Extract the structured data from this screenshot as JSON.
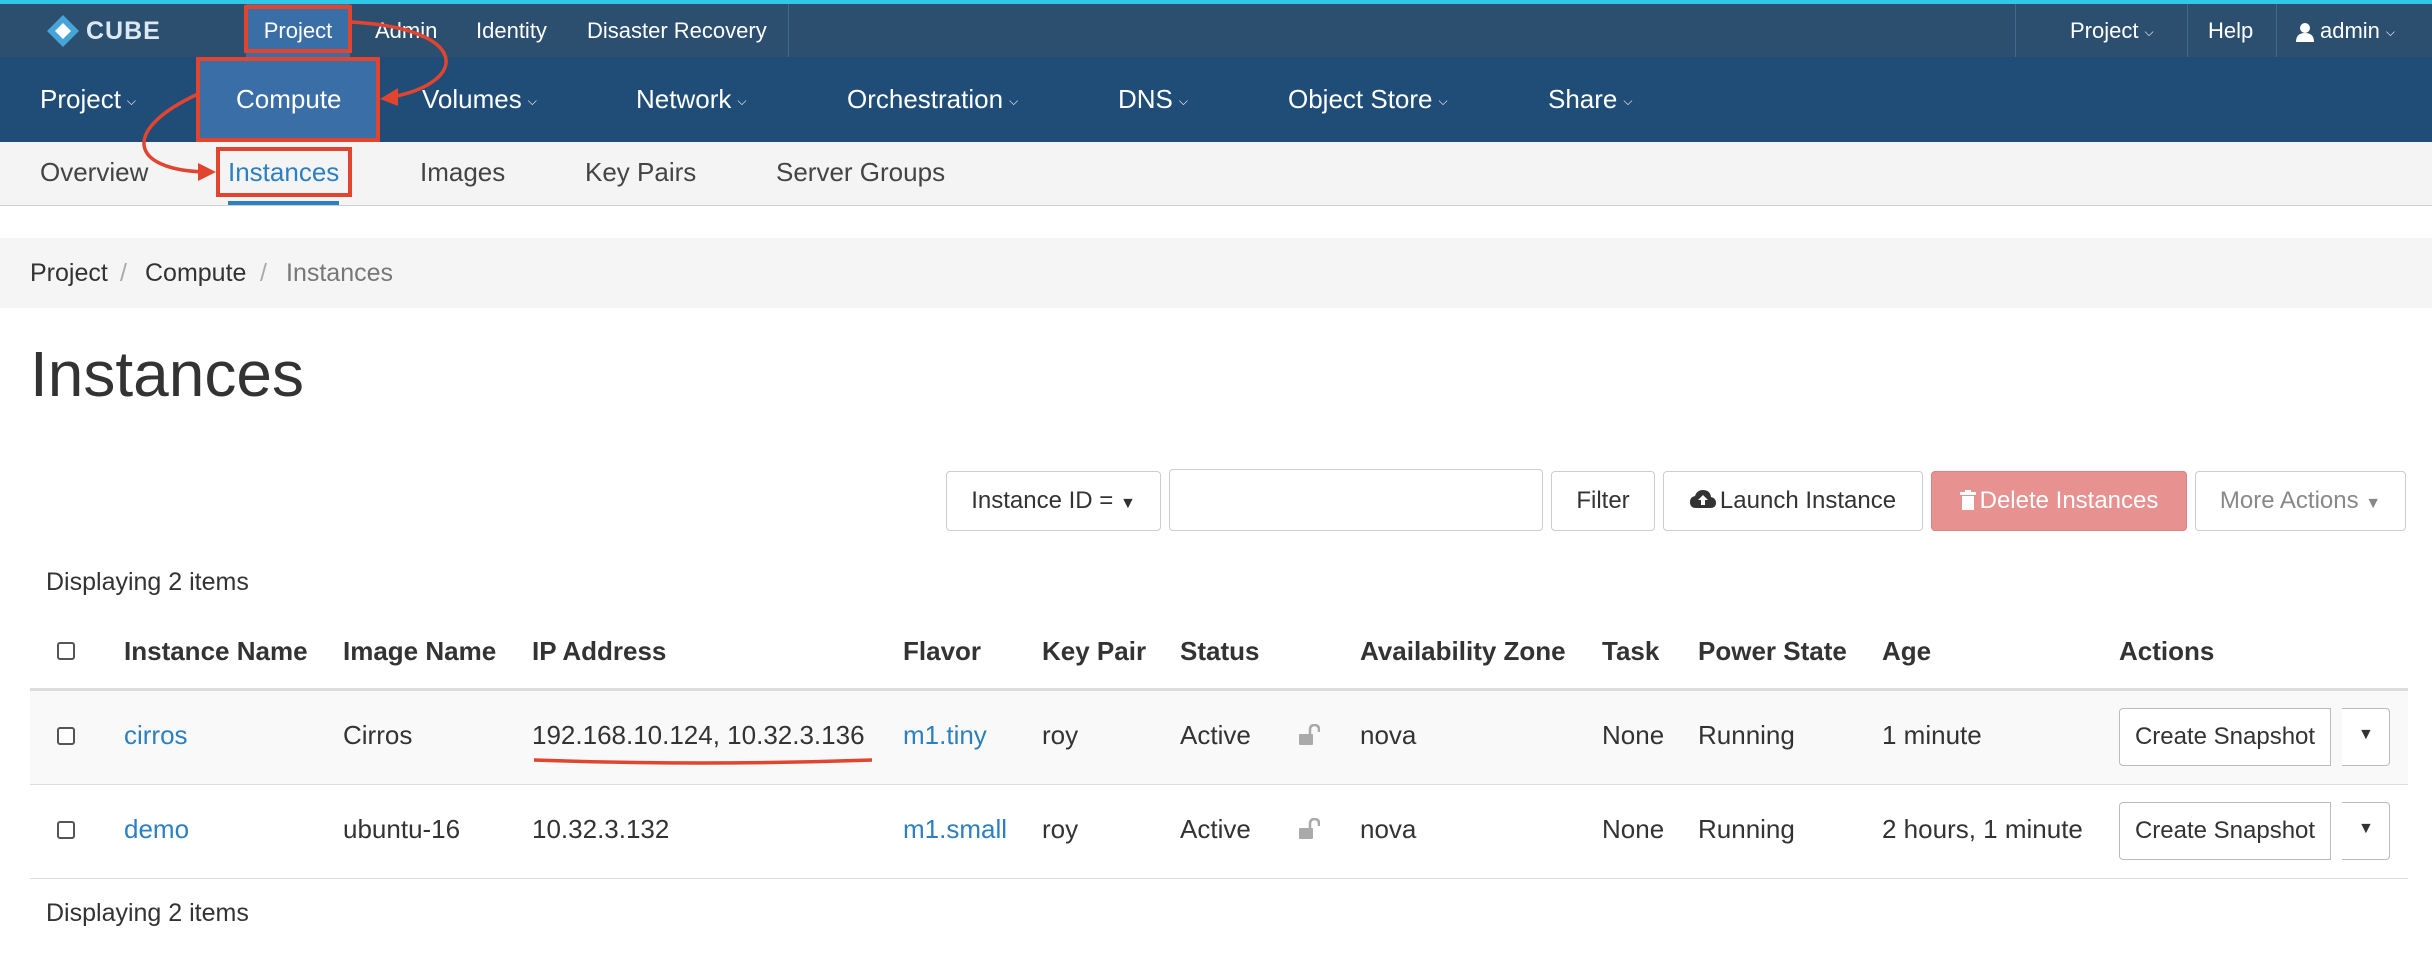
{
  "colors": {
    "top_bar": "#2c4f70",
    "main_nav": "#1f4d77",
    "active_tab": "#3a6ea7",
    "link": "#2c7fc1",
    "danger": "#e79191",
    "annotation": "#e1452f"
  },
  "brand": {
    "logo_text": "CUBE",
    "icon": "cube-diamond-icon"
  },
  "top_nav": {
    "items": [
      "Project",
      "Admin",
      "Identity",
      "Disaster Recovery"
    ],
    "right": {
      "project_menu": "Project",
      "help": "Help",
      "user": "admin"
    }
  },
  "main_nav": {
    "items": [
      "Project",
      "Compute",
      "Volumes",
      "Network",
      "Orchestration",
      "DNS",
      "Object Store",
      "Share"
    ]
  },
  "sub_nav": {
    "items": [
      "Overview",
      "Instances",
      "Images",
      "Key Pairs",
      "Server Groups"
    ]
  },
  "breadcrumb": {
    "items": [
      "Project",
      "Compute",
      "Instances"
    ],
    "separator": "/"
  },
  "page": {
    "title": "Instances"
  },
  "toolbar": {
    "filter_select": "Instance ID =",
    "search_value": "",
    "filter_button": "Filter",
    "launch_button": "Launch Instance",
    "delete_button": "Delete Instances",
    "more_actions": "More Actions"
  },
  "table": {
    "count_text": "Displaying 2 items",
    "headers": [
      "Instance Name",
      "Image Name",
      "IP Address",
      "Flavor",
      "Key Pair",
      "Status",
      "Availability Zone",
      "Task",
      "Power State",
      "Age",
      "Actions"
    ],
    "rows": [
      {
        "name": "cirros",
        "image": "Cirros",
        "ip": "192.168.10.124, 10.32.3.136",
        "flavor": "m1.tiny",
        "key_pair": "roy",
        "status": "Active",
        "zone": "nova",
        "task": "None",
        "power": "Running",
        "age": "1 minute",
        "action": "Create Snapshot"
      },
      {
        "name": "demo",
        "image": "ubuntu-16",
        "ip": "10.32.3.132",
        "flavor": "m1.small",
        "key_pair": "roy",
        "status": "Active",
        "zone": "nova",
        "task": "None",
        "power": "Running",
        "age": "2 hours, 1 minute",
        "action": "Create Snapshot"
      }
    ]
  }
}
